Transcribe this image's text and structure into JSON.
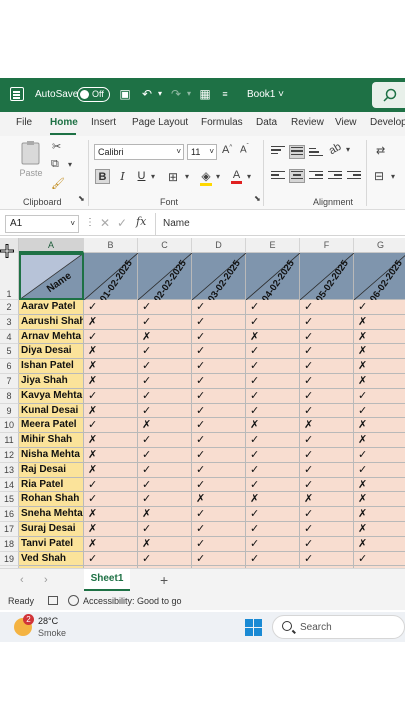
{
  "titlebar": {
    "autosave_label": "AutoSave",
    "autosave_state": "Off",
    "book_title": "Book1",
    "book_chevron": "˅"
  },
  "tabs": [
    "File",
    "Home",
    "Insert",
    "Page Layout",
    "Formulas",
    "Data",
    "Review",
    "View",
    "Develop"
  ],
  "active_tab": "Home",
  "ribbon": {
    "clipboard": {
      "paste_label": "Paste",
      "group_label": "Clipboard"
    },
    "font": {
      "font_name": "Calibri",
      "font_size": "11",
      "group_label": "Font",
      "bold": "B",
      "italic": "I",
      "underline": "U"
    },
    "alignment": {
      "group_label": "Alignment"
    }
  },
  "formula_bar": {
    "cell_ref": "A1",
    "content": "Name"
  },
  "columns": [
    "A",
    "B",
    "C",
    "D",
    "E",
    "F",
    "G"
  ],
  "header_row": {
    "name": "Name",
    "dates": [
      "01-02-2025",
      "02-02-2025",
      "03-02-2025",
      "04-02-2025",
      "05-02-2025",
      "06-02-2025"
    ]
  },
  "rows": [
    {
      "num": "2",
      "name": "Aarav Patel",
      "marks": [
        "✓",
        "✓",
        "✓",
        "✓",
        "✓",
        "✓"
      ]
    },
    {
      "num": "3",
      "name": "Aarushi Shah",
      "marks": [
        "✗",
        "✓",
        "✓",
        "✓",
        "✓",
        "✗"
      ]
    },
    {
      "num": "4",
      "name": "Arnav Mehta",
      "marks": [
        "✓",
        "✗",
        "✓",
        "✗",
        "✓",
        "✗"
      ]
    },
    {
      "num": "5",
      "name": "Diya Desai",
      "marks": [
        "✗",
        "✓",
        "✓",
        "✓",
        "✓",
        "✗"
      ]
    },
    {
      "num": "6",
      "name": "Ishan Patel",
      "marks": [
        "✗",
        "✓",
        "✓",
        "✓",
        "✓",
        "✗"
      ]
    },
    {
      "num": "7",
      "name": "Jiya Shah",
      "marks": [
        "✗",
        "✓",
        "✓",
        "✓",
        "✓",
        "✗"
      ]
    },
    {
      "num": "8",
      "name": "Kavya Mehta",
      "marks": [
        "✓",
        "✓",
        "✓",
        "✓",
        "✓",
        "✓"
      ]
    },
    {
      "num": "9",
      "name": "Kunal Desai",
      "marks": [
        "✗",
        "✓",
        "✓",
        "✓",
        "✓",
        "✓"
      ]
    },
    {
      "num": "10",
      "name": "Meera Patel",
      "marks": [
        "✓",
        "✗",
        "✓",
        "✗",
        "✗",
        "✗"
      ]
    },
    {
      "num": "11",
      "name": "Mihir Shah",
      "marks": [
        "✗",
        "✓",
        "✓",
        "✓",
        "✓",
        "✗"
      ]
    },
    {
      "num": "12",
      "name": "Nisha Mehta",
      "marks": [
        "✗",
        "✓",
        "✓",
        "✓",
        "✓",
        "✓"
      ]
    },
    {
      "num": "13",
      "name": "Raj Desai",
      "marks": [
        "✗",
        "✓",
        "✓",
        "✓",
        "✓",
        "✓"
      ]
    },
    {
      "num": "14",
      "name": "Ria Patel",
      "marks": [
        "✓",
        "✓",
        "✓",
        "✓",
        "✓",
        "✗"
      ]
    },
    {
      "num": "15",
      "name": "Rohan Shah",
      "marks": [
        "✓",
        "✓",
        "✗",
        "✗",
        "✗",
        "✗"
      ]
    },
    {
      "num": "16",
      "name": "Sneha Mehta",
      "marks": [
        "✗",
        "✗",
        "✓",
        "✓",
        "✓",
        "✗"
      ]
    },
    {
      "num": "17",
      "name": "Suraj Desai",
      "marks": [
        "✗",
        "✓",
        "✓",
        "✓",
        "✓",
        "✗"
      ]
    },
    {
      "num": "18",
      "name": "Tanvi Patel",
      "marks": [
        "✗",
        "✗",
        "✓",
        "✓",
        "✓",
        "✗"
      ]
    },
    {
      "num": "19",
      "name": "Ved Shah",
      "marks": [
        "✓",
        "✓",
        "✓",
        "✓",
        "✓",
        "✓"
      ]
    }
  ],
  "sheet_tabs": {
    "active": "Sheet1",
    "add": "+"
  },
  "status_bar": {
    "ready": "Ready",
    "accessibility": "Accessibility: Good to go"
  },
  "taskbar": {
    "temperature": "28°C",
    "condition": "Smoke",
    "badge": "2",
    "search_placeholder": "Search"
  },
  "colors": {
    "excel_green": "#1e7145",
    "name_fill": "#fbe39a",
    "mark_fill": "#f8ddd0",
    "header_fill": "#7f95ad"
  }
}
